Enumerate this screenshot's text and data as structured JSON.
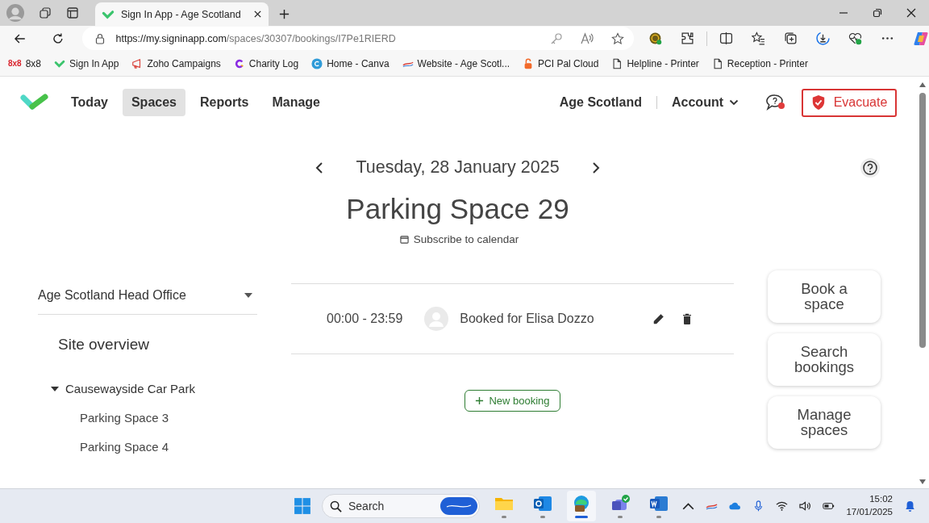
{
  "browser": {
    "tab": {
      "title": "Sign In App - Age Scotland",
      "selected": true
    },
    "url": {
      "host": "https://my.signinapp.com",
      "path": "/spaces/30307/bookings/I7Pe1RIERD"
    },
    "bookmarks": [
      {
        "kind": "logo-text",
        "logo": "8x8",
        "label": "8x8"
      },
      {
        "kind": "check",
        "label": "Sign In App"
      },
      {
        "kind": "megaphone",
        "label": "Zoho Campaigns"
      },
      {
        "kind": "c-logo",
        "label": "Charity Log"
      },
      {
        "kind": "canva",
        "label": "Home - Canva"
      },
      {
        "kind": "swoosh",
        "label": "Website - Age Scotl..."
      },
      {
        "kind": "lock",
        "label": "PCI Pal Cloud"
      },
      {
        "kind": "page",
        "label": "Helpline - Printer"
      },
      {
        "kind": "page",
        "label": "Reception - Printer"
      }
    ]
  },
  "nav": {
    "items": [
      {
        "label": "Today",
        "selected": false
      },
      {
        "label": "Spaces",
        "selected": true
      },
      {
        "label": "Reports",
        "selected": false
      },
      {
        "label": "Manage",
        "selected": false
      }
    ],
    "organisation": "Age Scotland",
    "account": "Account",
    "evacuate": "Evacuate",
    "notification": true
  },
  "header": {
    "date": "Tuesday, 28 January 2025",
    "title": "Parking Space 29",
    "subscribe": "Subscribe to calendar"
  },
  "sidebar": {
    "site": "Age Scotland Head Office",
    "heading": "Site overview",
    "tree": [
      {
        "label": "Causewayside Car Park",
        "expanded": true,
        "children": [
          {
            "label": "Parking Space 3"
          },
          {
            "label": "Parking Space 4"
          }
        ]
      }
    ]
  },
  "bookings": [
    {
      "time": "00:00 - 23:59",
      "label": "Booked for Elisa Dozzo"
    }
  ],
  "new_booking": "New booking",
  "actions": [
    "Book a space",
    "Search bookings",
    "Manage spaces"
  ],
  "taskbar": {
    "search": {
      "placeholder": "Search"
    },
    "apps": [
      {
        "kind": "folder",
        "selected": false
      },
      {
        "kind": "outlook",
        "selected": false
      },
      {
        "kind": "edge",
        "selected": true
      },
      {
        "kind": "teams",
        "selected": false
      },
      {
        "kind": "word",
        "selected": false
      }
    ],
    "time": "15:02",
    "date": "17/01/2025"
  }
}
